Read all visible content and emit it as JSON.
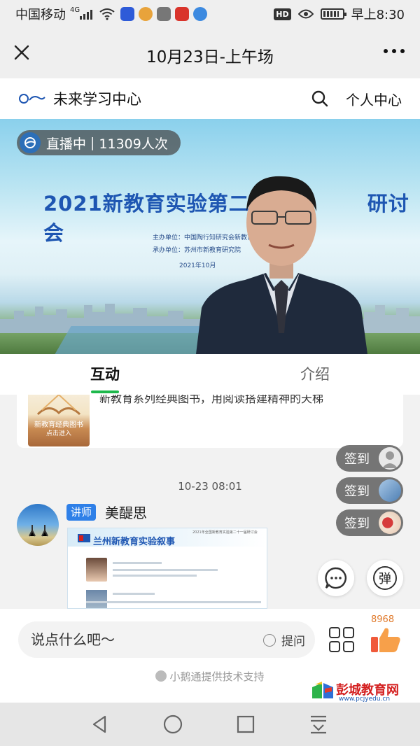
{
  "status_bar": {
    "carrier": "中国移动",
    "network": "4G",
    "hd": "HD",
    "time": "早上8:30"
  },
  "titlebar": {
    "title": "10月23日-上午场"
  },
  "app_header": {
    "name": "未来学习中心",
    "personal": "个人中心"
  },
  "live": {
    "status": "直播中",
    "viewers": "11309人次",
    "slide_title": "2021新教育实验第二",
    "slide_title_right": "研讨会",
    "organizer": "主办单位：中国陶行知研究会新教育分会",
    "co_organizer": "承办单位：苏州市新教育研究院",
    "date": "2021年10月"
  },
  "tabs": [
    {
      "label": "互动"
    },
    {
      "label": "介绍"
    }
  ],
  "chat": {
    "book_card": {
      "thumb_title": "新教育经典图书",
      "thumb_action": "点击进入",
      "description": "新教育系列经典图书，用阅读搭建精神的天梯"
    },
    "timestamp": "10-23 08:01",
    "message": {
      "role": "讲师",
      "sender": "美醍思",
      "image_title": "兰州新教育实验叙事",
      "image_header": "2021年全国新教育实验第二十一届研讨会"
    }
  },
  "floating": {
    "signin_label": "签到",
    "danmaku_label": "弹"
  },
  "input": {
    "placeholder": "说点什么吧〜",
    "ask_label": "提问",
    "likes": "8968"
  },
  "footer": {
    "powered_by": "小鹅通提供技术支持",
    "watermark_name": "彭城教育网",
    "watermark_url": "www.pcjyedu.cn"
  },
  "colors": {
    "accent_green": "#1db84b",
    "role_blue": "#2f80e8",
    "likes_orange": "#e07a2c"
  }
}
